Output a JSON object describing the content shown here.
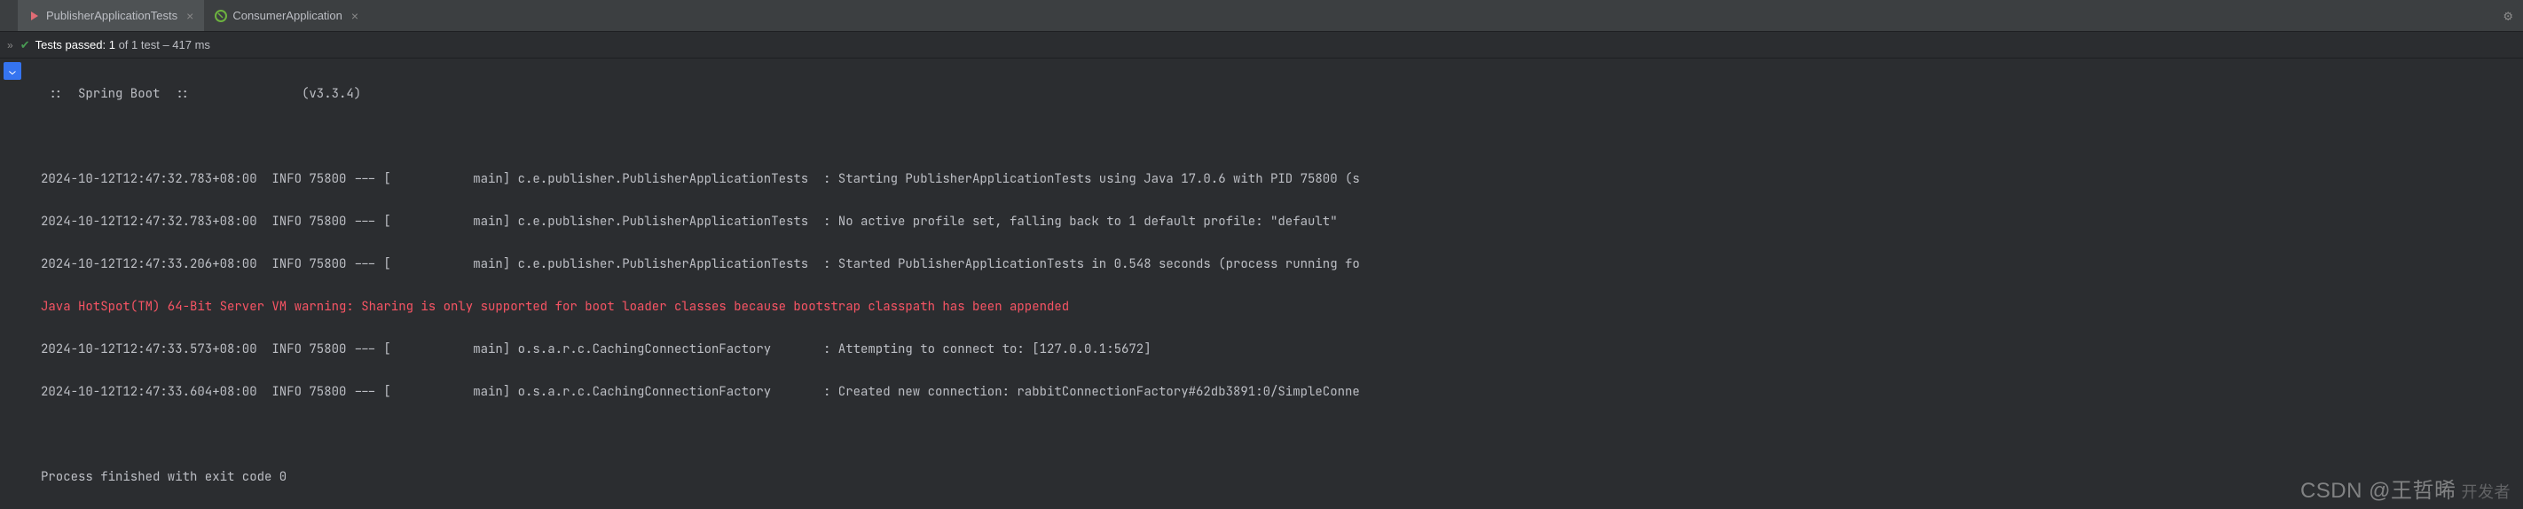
{
  "tabs": {
    "tab1": "PublisherApplicationTests",
    "tab2": "ConsumerApplication"
  },
  "status": {
    "label_prefix": "Tests passed:",
    "passed": "1",
    "of_text": "of 1 test – 417 ms"
  },
  "console": {
    "header": " ::  Spring Boot  ::               (v3.3.4)",
    "lines": [
      "2024-10-12T12:47:32.783+08:00  INFO 75800 --- [           main] c.e.publisher.PublisherApplicationTests  : Starting PublisherApplicationTests using Java 17.0.6 with PID 75800 (s",
      "2024-10-12T12:47:32.783+08:00  INFO 75800 --- [           main] c.e.publisher.PublisherApplicationTests  : No active profile set, falling back to 1 default profile: \"default\"",
      "2024-10-12T12:47:33.206+08:00  INFO 75800 --- [           main] c.e.publisher.PublisherApplicationTests  : Started PublisherApplicationTests in 0.548 seconds (process running fo"
    ],
    "warning": "Java HotSpot(TM) 64-Bit Server VM warning: Sharing is only supported for boot loader classes because bootstrap classpath has been appended",
    "lines2": [
      "2024-10-12T12:47:33.573+08:00  INFO 75800 --- [           main] o.s.a.r.c.CachingConnectionFactory       : Attempting to connect to: [127.0.0.1:5672]",
      "2024-10-12T12:47:33.604+08:00  INFO 75800 --- [           main] o.s.a.r.c.CachingConnectionFactory       : Created new connection: rabbitConnectionFactory#62db3891:0/SimpleConne"
    ],
    "exit": "Process finished with exit code 0"
  },
  "watermark": {
    "main": "CSDN @王哲晞",
    "sub": "开发者"
  }
}
